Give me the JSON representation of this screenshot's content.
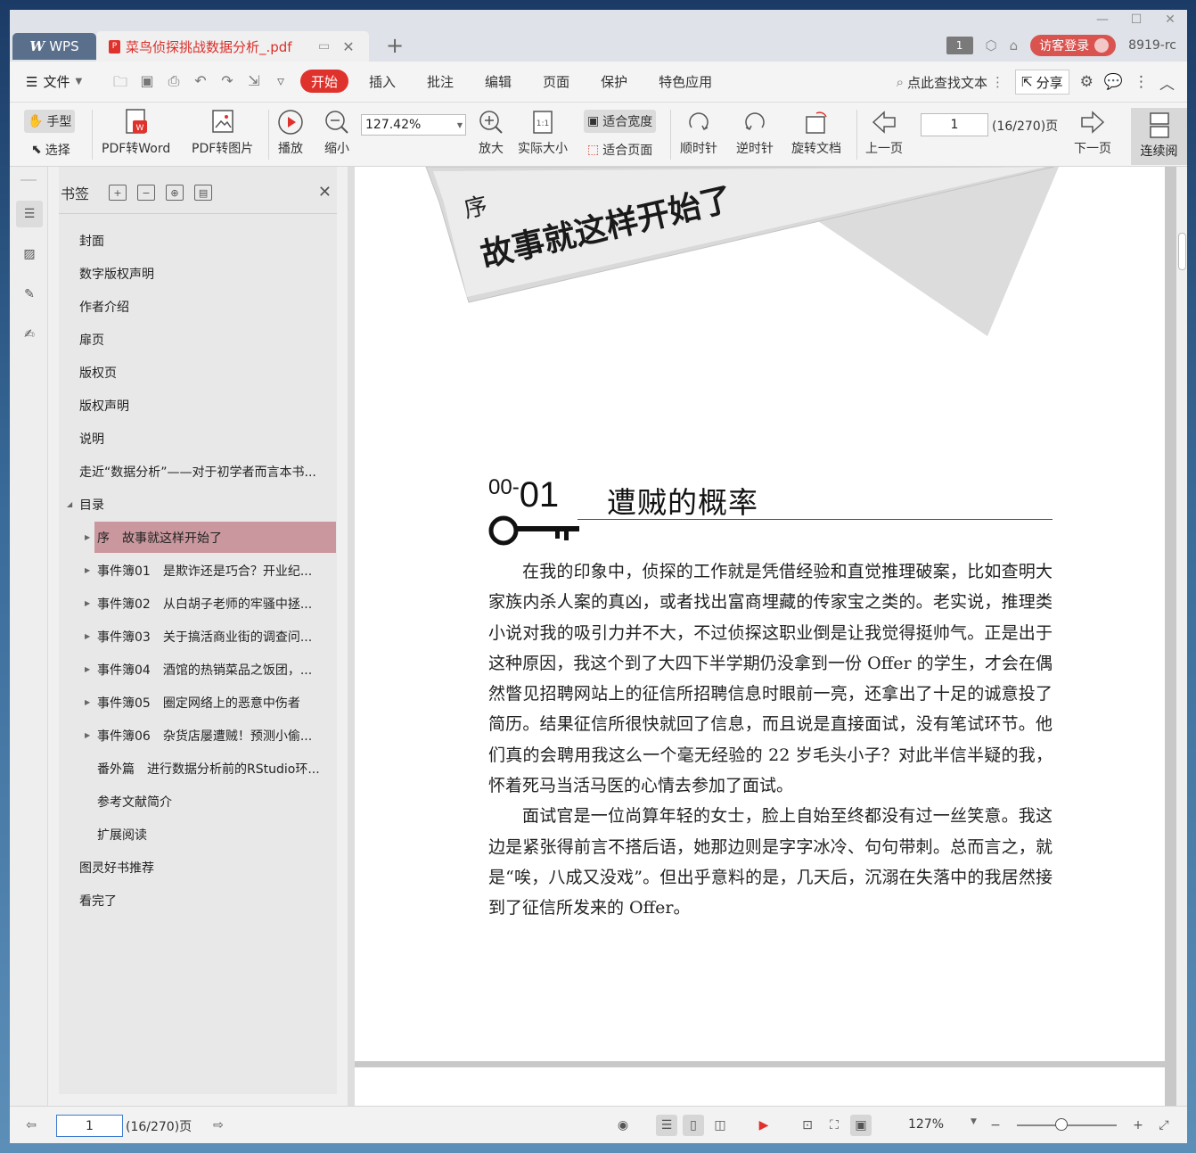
{
  "app": {
    "wps_tab": "WPS",
    "doc_tab": "菜鸟侦探挑战数据分析_.pdf",
    "tab_count_badge": "1",
    "login_button": "访客登录",
    "version": "8919-rc"
  },
  "menubar": {
    "file_menu": "文件",
    "tabs": [
      "开始",
      "插入",
      "批注",
      "编辑",
      "页面",
      "保护",
      "特色应用"
    ],
    "active_tab": "开始",
    "search_label": "点此查找文本",
    "share_label": "分享"
  },
  "toolbar": {
    "hand_tool": "手型",
    "select_tool": "选择",
    "pdf_to_word": "PDF转Word",
    "pdf_to_image": "PDF转图片",
    "play": "播放",
    "zoom_out": "缩小",
    "zoom_value": "127.42%",
    "zoom_in": "放大",
    "actual_size": "实际大小",
    "fit_width": "适合宽度",
    "fit_page": "适合页面",
    "rotate_cw": "顺时针",
    "rotate_ccw": "逆时针",
    "rotate_doc": "旋转文档",
    "prev_page": "上一页",
    "page_input": "1",
    "page_total": "(16/270)页",
    "next_page": "下一页",
    "continuous": "连续阅"
  },
  "bookmarks": {
    "title": "书签",
    "items": [
      {
        "label": "封面",
        "level": 0,
        "arrow": "",
        "selected": false
      },
      {
        "label": "数字版权声明",
        "level": 0,
        "arrow": "",
        "selected": false
      },
      {
        "label": "作者介绍",
        "level": 0,
        "arrow": "",
        "selected": false
      },
      {
        "label": "扉页",
        "level": 0,
        "arrow": "",
        "selected": false
      },
      {
        "label": "版权页",
        "level": 0,
        "arrow": "",
        "selected": false
      },
      {
        "label": "版权声明",
        "level": 0,
        "arrow": "",
        "selected": false
      },
      {
        "label": "说明",
        "level": 0,
        "arrow": "",
        "selected": false
      },
      {
        "label": "走近“数据分析”——对于初学者而言本书...",
        "level": 0,
        "arrow": "",
        "selected": false
      },
      {
        "label": "目录",
        "level": 0,
        "arrow": "expanded",
        "selected": false
      },
      {
        "label": "序　故事就这样开始了",
        "level": 1,
        "arrow": "collapsed",
        "selected": true
      },
      {
        "label": "事件簿01　是欺诈还是巧合？开业纪...",
        "level": 1,
        "arrow": "collapsed",
        "selected": false
      },
      {
        "label": "事件簿02　从白胡子老师的牢骚中拯...",
        "level": 1,
        "arrow": "collapsed",
        "selected": false
      },
      {
        "label": "事件簿03　关于搞活商业街的调查问...",
        "level": 1,
        "arrow": "collapsed",
        "selected": false
      },
      {
        "label": "事件簿04　酒馆的热销菜品之饭团，...",
        "level": 1,
        "arrow": "collapsed",
        "selected": false
      },
      {
        "label": "事件簿05　圈定网络上的恶意中伤者",
        "level": 1,
        "arrow": "collapsed",
        "selected": false
      },
      {
        "label": "事件簿06　杂货店屡遭贼！预测小偷...",
        "level": 1,
        "arrow": "collapsed",
        "selected": false
      },
      {
        "label": "番外篇　进行数据分析前的RStudio环...",
        "level": 1,
        "arrow": "",
        "selected": false
      },
      {
        "label": "参考文献简介",
        "level": 1,
        "arrow": "",
        "selected": false
      },
      {
        "label": "扩展阅读",
        "level": 1,
        "arrow": "",
        "selected": false
      },
      {
        "label": "图灵好书推荐",
        "level": 0,
        "arrow": "",
        "selected": false
      },
      {
        "label": "看完了",
        "level": 0,
        "arrow": "",
        "selected": false
      }
    ]
  },
  "document": {
    "banner_small": "序",
    "banner_title": "故事就这样开始了",
    "chapter_prefix": "00-",
    "chapter_number": "01",
    "chapter_title": "遭贼的概率",
    "paragraph1": "在我的印象中，侦探的工作就是凭借经验和直觉推理破案，比如查明大家族内杀人案的真凶，或者找出富商埋藏的传家宝之类的。老实说，推理类小说对我的吸引力并不大，不过侦探这职业倒是让我觉得挺帅气。正是出于这种原因，我这个到了大四下半学期仍没拿到一份 Offer 的学生，才会在偶然瞥见招聘网站上的征信所招聘信息时眼前一亮，还拿出了十足的诚意投了简历。结果征信所很快就回了信息，而且说是直接面试，没有笔试环节。他们真的会聘用我这么一个毫无经验的 22 岁毛头小子？对此半信半疑的我，怀着死马当活马医的心情去参加了面试。",
    "paragraph2": "面试官是一位尚算年轻的女士，脸上自始至终都没有过一丝笑意。我这边是紧张得前言不搭后语，她那边则是字字冰冷、句句带刺。总而言之，就是“唉，八成又没戏”。但出乎意料的是，几天后，沉溺在失落中的我居然接到了征信所发来的 Offer。"
  },
  "statusbar": {
    "page_input": "1",
    "page_total": "(16/270)页",
    "zoom_label": "127%",
    "zoom_fraction": 0.45
  },
  "colors": {
    "accent": "#e0322c",
    "selected_bookmark": "#c9979d"
  }
}
